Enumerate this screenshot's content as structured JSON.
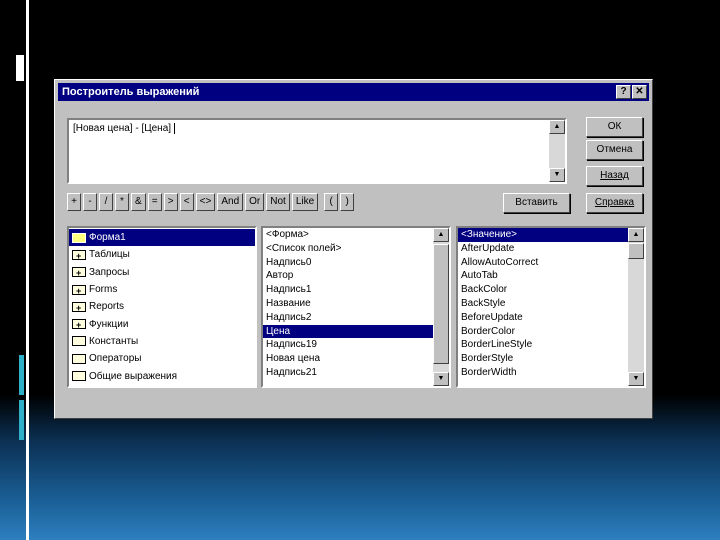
{
  "dialog": {
    "title": "Построитель выражений",
    "help_btn": "?",
    "close_btn": "✕"
  },
  "expression": {
    "value": "[Новая цена] - [Цена]"
  },
  "buttons": {
    "ok": "ОК",
    "cancel": "Отмена",
    "back": "Назад",
    "paste": "Вставить",
    "help": "Справка"
  },
  "operators": [
    "+",
    "-",
    "/",
    "*",
    "&",
    "=",
    ">",
    "<",
    "<>",
    "And",
    "Or",
    "Not",
    "Like",
    "(",
    ")"
  ],
  "folders": [
    {
      "label": "Форма1",
      "type": "open",
      "selected": true
    },
    {
      "label": "Таблицы",
      "type": "plus"
    },
    {
      "label": "Запросы",
      "type": "plus"
    },
    {
      "label": "Forms",
      "type": "plus"
    },
    {
      "label": "Reports",
      "type": "plus"
    },
    {
      "label": "Функции",
      "type": "plus"
    },
    {
      "label": "Константы",
      "type": "plain"
    },
    {
      "label": "Операторы",
      "type": "plain"
    },
    {
      "label": "Общие выражения",
      "type": "plain"
    }
  ],
  "fields": [
    {
      "label": "<Форма>"
    },
    {
      "label": "<Список полей>"
    },
    {
      "label": "Надпись0"
    },
    {
      "label": "Автор"
    },
    {
      "label": "Надпись1"
    },
    {
      "label": "Название"
    },
    {
      "label": "Надпись2"
    },
    {
      "label": "Цена",
      "selected": true
    },
    {
      "label": "Надпись19"
    },
    {
      "label": "Новая цена"
    },
    {
      "label": "Надпись21"
    }
  ],
  "values": [
    {
      "label": "<Значение>",
      "selected": true
    },
    {
      "label": "AfterUpdate"
    },
    {
      "label": "AllowAutoCorrect"
    },
    {
      "label": "AutoTab"
    },
    {
      "label": "BackColor"
    },
    {
      "label": "BackStyle"
    },
    {
      "label": "BeforeUpdate"
    },
    {
      "label": "BorderColor"
    },
    {
      "label": "BorderLineStyle"
    },
    {
      "label": "BorderStyle"
    },
    {
      "label": "BorderWidth"
    }
  ],
  "scroll_arrows": {
    "up": "▲",
    "down": "▼"
  }
}
